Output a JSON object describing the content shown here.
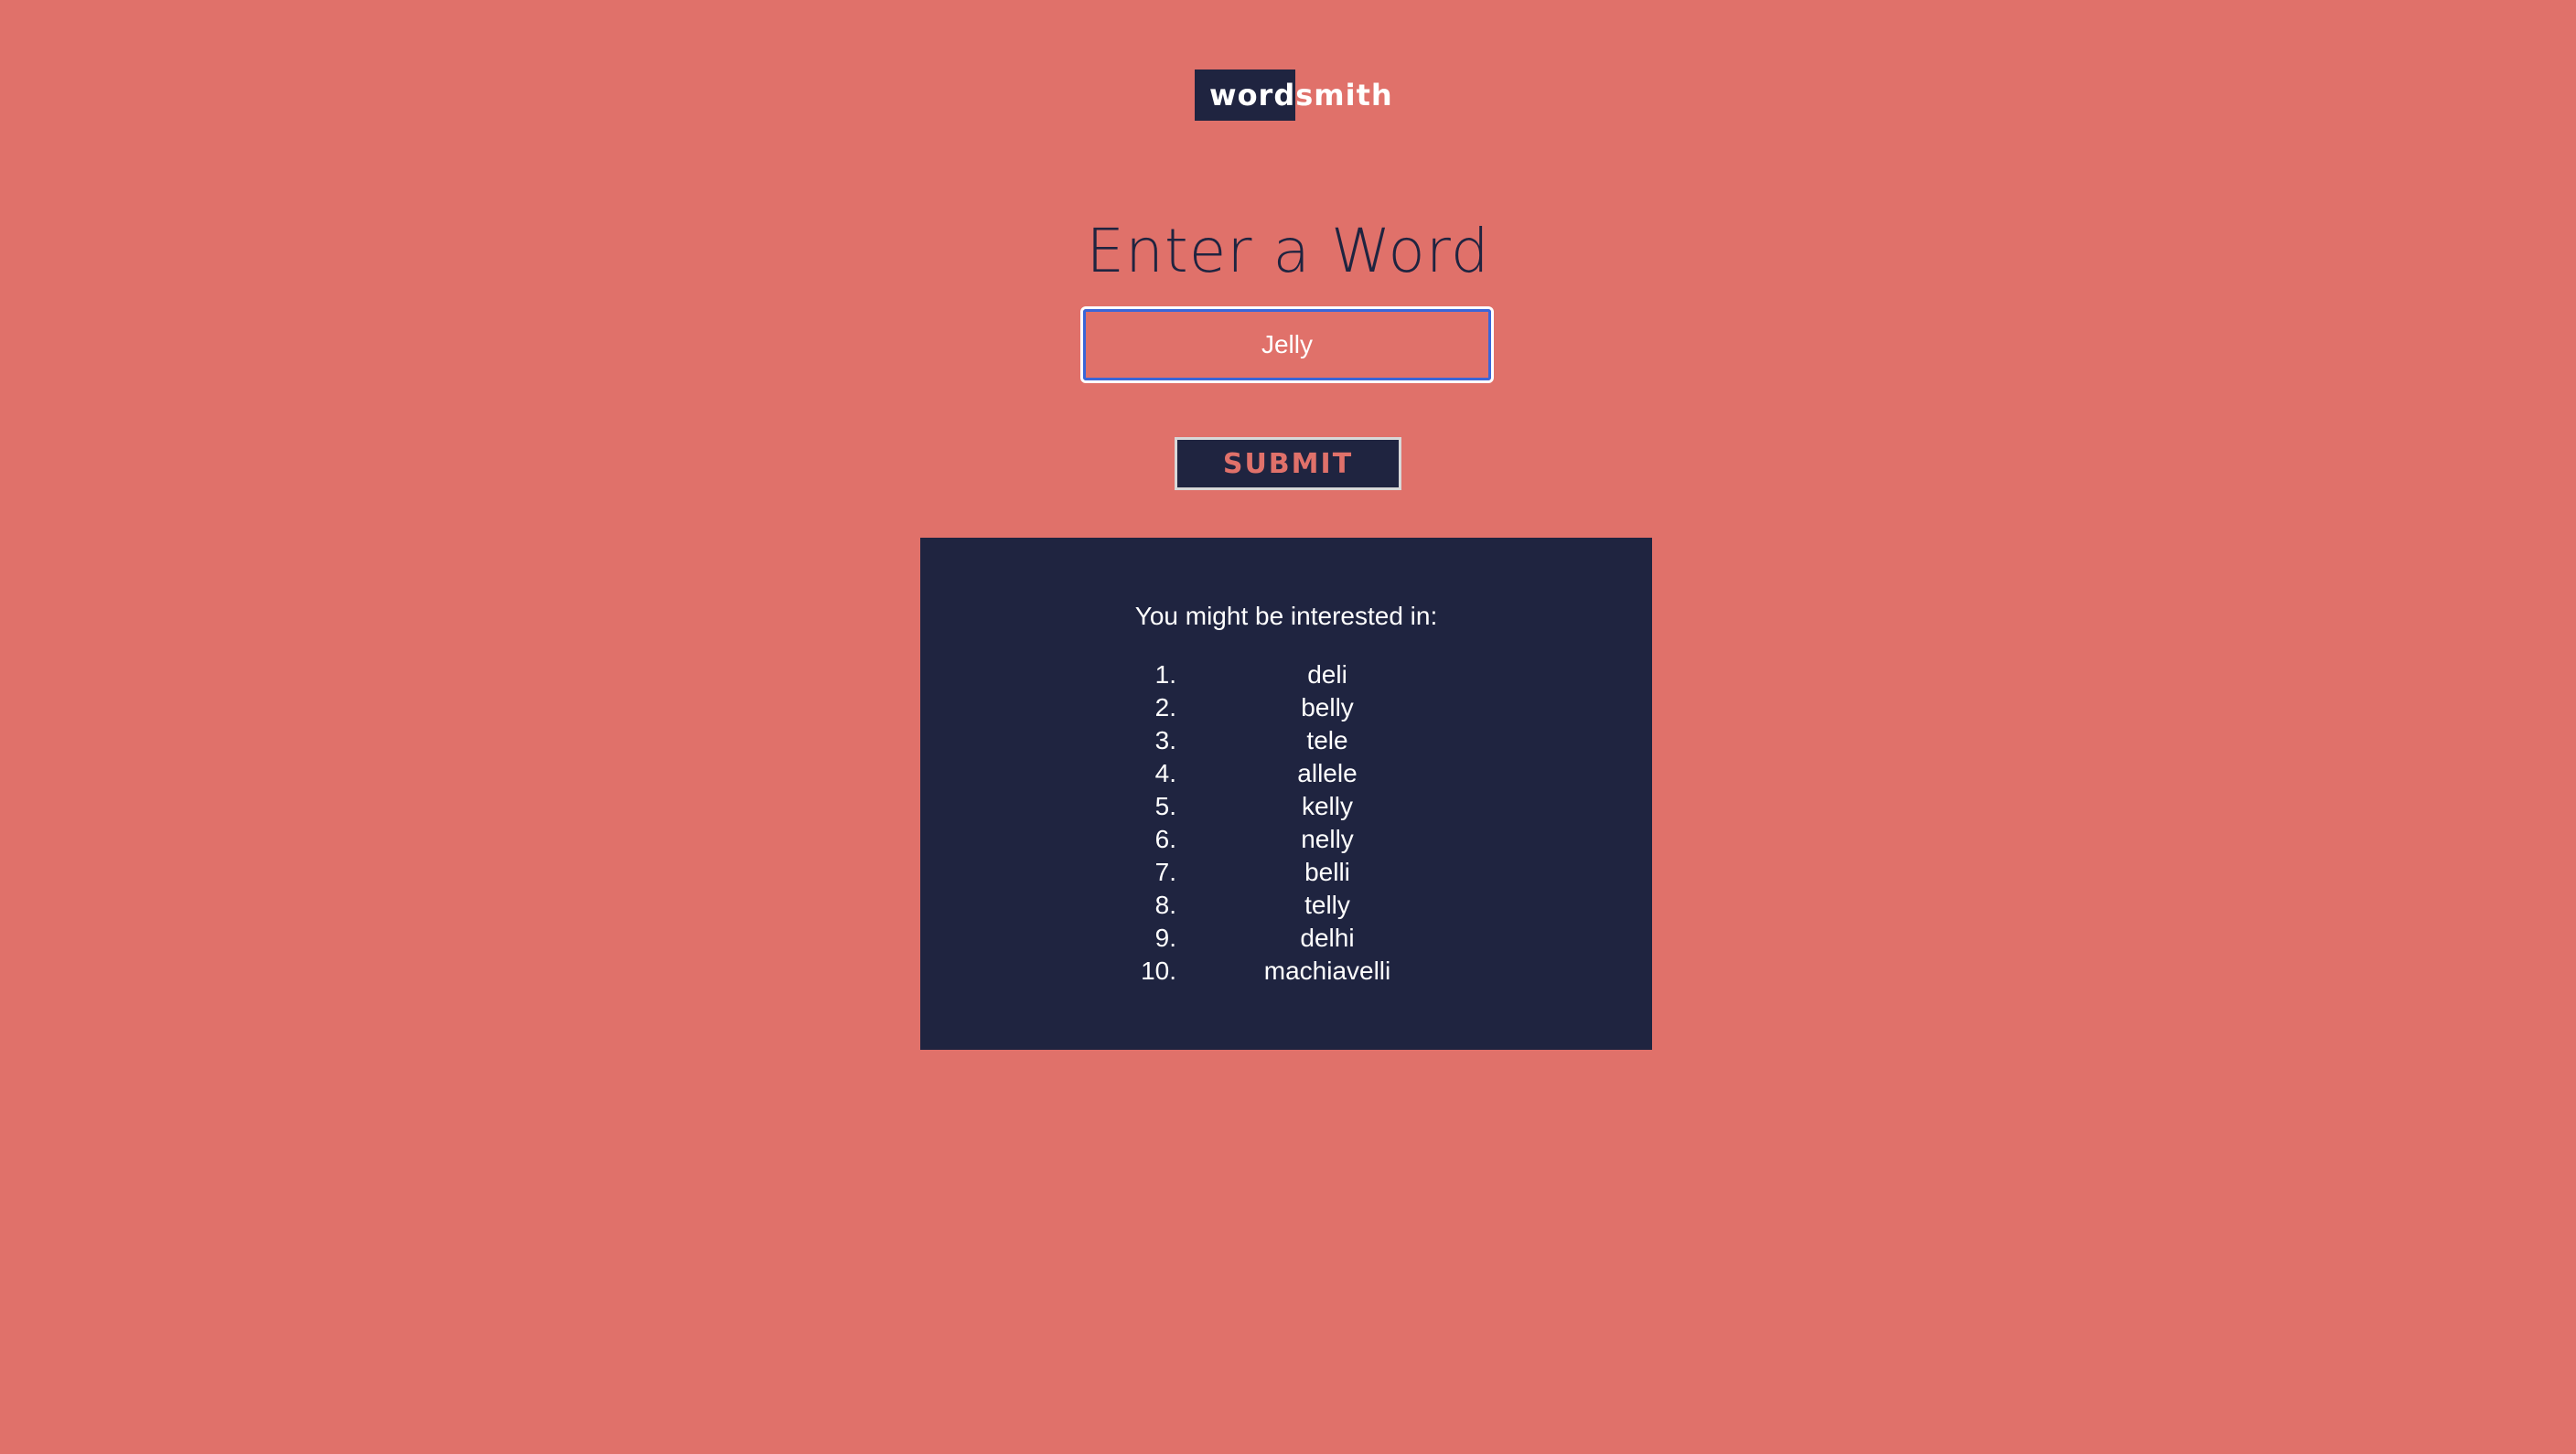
{
  "app": {
    "logo_part1": "word",
    "logo_part2": "smith"
  },
  "form": {
    "heading": "Enter a Word",
    "input_value": "Jelly",
    "submit_label": "SUBMIT"
  },
  "results": {
    "heading": "You might be interested in:",
    "items": [
      {
        "num": "1.",
        "word": "deli"
      },
      {
        "num": "2.",
        "word": "belly"
      },
      {
        "num": "3.",
        "word": "tele"
      },
      {
        "num": "4.",
        "word": "allele"
      },
      {
        "num": "5.",
        "word": "kelly"
      },
      {
        "num": "6.",
        "word": "nelly"
      },
      {
        "num": "7.",
        "word": "belli"
      },
      {
        "num": "8.",
        "word": "telly"
      },
      {
        "num": "9.",
        "word": "delhi"
      },
      {
        "num": "10.",
        "word": "machiavelli"
      }
    ]
  },
  "colors": {
    "background": "#e0716a",
    "navy": "#1f2440",
    "focus_ring": "#3a66d8"
  }
}
